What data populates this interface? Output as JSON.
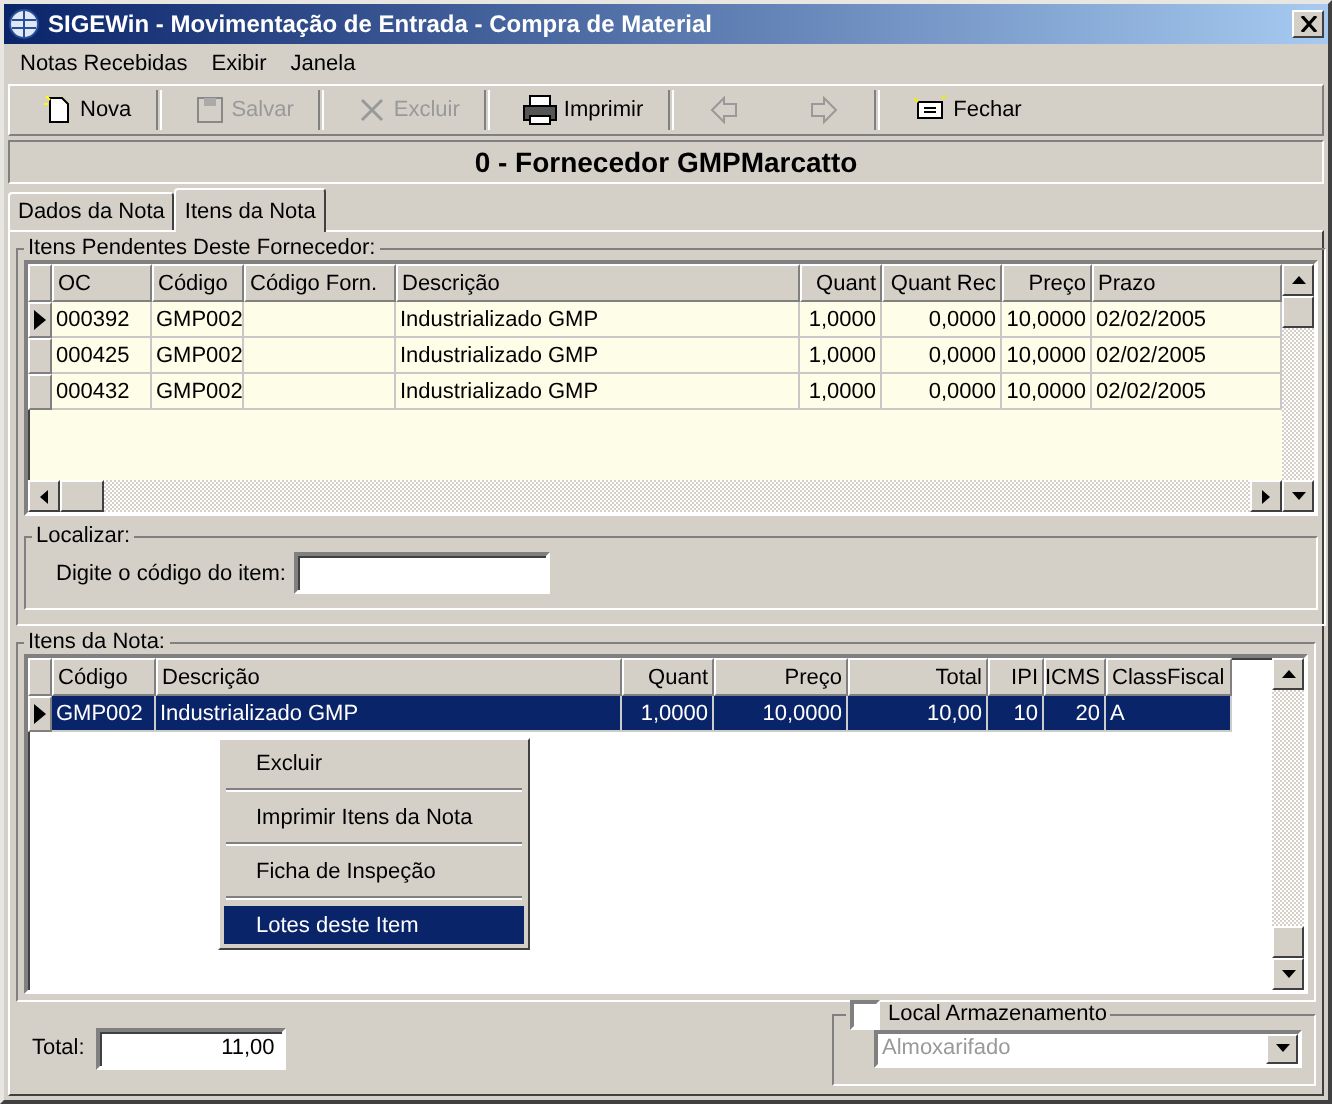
{
  "window": {
    "title": "SIGEWin - Movimentação de Entrada - Compra de Material"
  },
  "menu": [
    "Notas Recebidas",
    "Exibir",
    "Janela"
  ],
  "toolbar": [
    {
      "kind": "new",
      "label": "Nova",
      "disabled": false
    },
    {
      "kind": "save",
      "label": "Salvar",
      "disabled": true
    },
    {
      "kind": "delete",
      "label": "Excluir",
      "disabled": true
    },
    {
      "kind": "print",
      "label": "Imprimir",
      "disabled": false
    },
    {
      "kind": "back",
      "disabled": true
    },
    {
      "kind": "forward",
      "disabled": true
    },
    {
      "kind": "close",
      "label": "Fechar",
      "disabled": false
    }
  ],
  "header": "0 - Fornecedor GMPMarcatto",
  "tabs": [
    {
      "label": "Dados da Nota",
      "selected": false
    },
    {
      "label": "Itens da Nota",
      "selected": true
    }
  ],
  "pending": {
    "title": "Itens Pendentes Deste Fornecedor:",
    "columns": [
      "OC",
      "Código",
      "Código Forn.",
      "Descrição",
      "Quant",
      "Quant Rec",
      "Preço",
      "Prazo"
    ],
    "rows": [
      {
        "current": true,
        "cells": [
          "000392",
          "GMP002",
          "",
          "Industrializado GMP",
          "1,0000",
          "0,0000",
          "10,0000",
          "02/02/2005"
        ]
      },
      {
        "current": false,
        "cells": [
          "000425",
          "GMP002",
          "",
          "Industrializado GMP",
          "1,0000",
          "0,0000",
          "10,0000",
          "02/02/2005"
        ]
      },
      {
        "current": false,
        "cells": [
          "000432",
          "GMP002",
          "",
          "Industrializado GMP",
          "1,0000",
          "0,0000",
          "10,0000",
          "02/02/2005"
        ]
      }
    ]
  },
  "search": {
    "title": "Localizar:",
    "label": "Digite o código do item:"
  },
  "items": {
    "title": "Itens da Nota:",
    "columns": [
      "Código",
      "Descrição",
      "Quant",
      "Preço",
      "Total",
      "IPI",
      "ICMS",
      "ClassFiscal"
    ],
    "rows": [
      {
        "current": true,
        "selected": true,
        "cells": [
          "GMP002",
          "Industrializado GMP",
          "1,0000",
          "10,0000",
          "10,00",
          "10",
          "20",
          "A"
        ]
      }
    ]
  },
  "context_menu": [
    {
      "label": "Excluir",
      "selected": false
    },
    {
      "label": "Imprimir Itens da Nota",
      "selected": false
    },
    {
      "label": "Ficha de Inspeção",
      "selected": false
    },
    {
      "label": "Lotes deste Item",
      "selected": true
    }
  ],
  "total": {
    "label": "Total:",
    "value": "11,00"
  },
  "storage": {
    "label": "Local Armazenamento",
    "checked": false,
    "value": "Almoxarifado",
    "disabled": true
  }
}
